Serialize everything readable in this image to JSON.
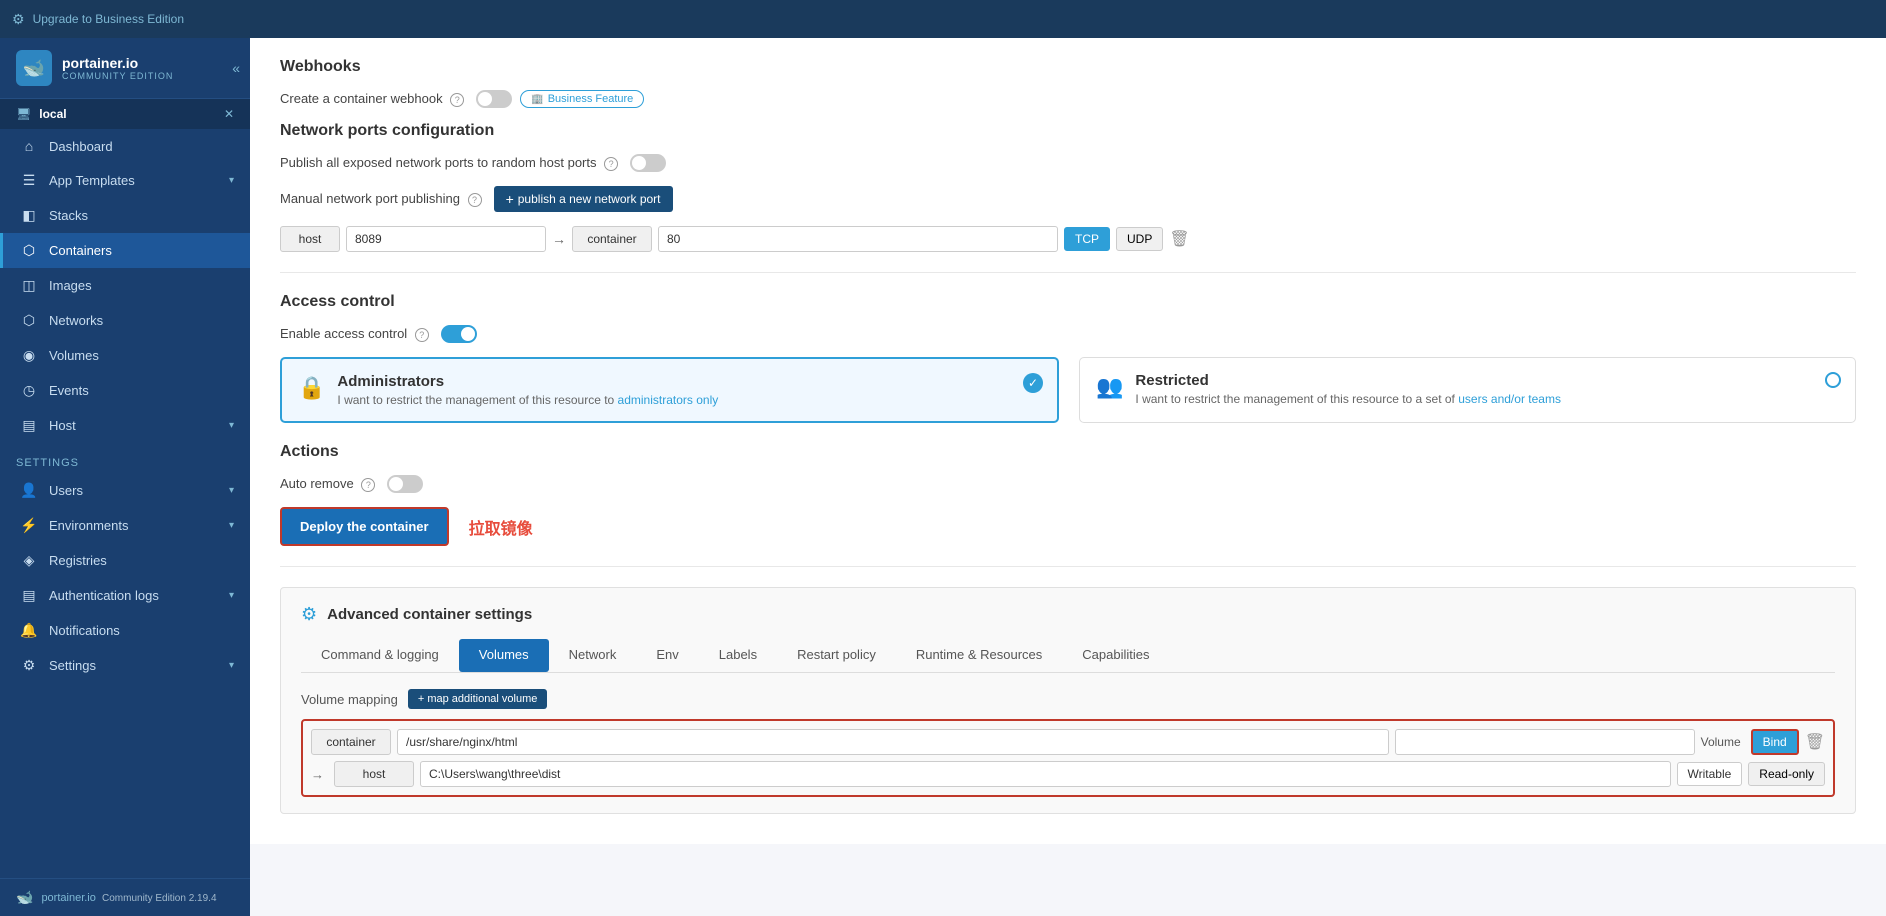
{
  "topBanner": {
    "icon": "⚙",
    "label": "Upgrade to Business Edition"
  },
  "sidebar": {
    "logo": {
      "name": "portainer.io",
      "edition": "COMMUNITY EDITION"
    },
    "envSection": {
      "name": "local",
      "closeIcon": "✕"
    },
    "navItems": [
      {
        "id": "dashboard",
        "icon": "⊞",
        "label": "Dashboard",
        "active": false
      },
      {
        "id": "app-templates",
        "icon": "☰",
        "label": "App Templates",
        "active": false,
        "hasChevron": true
      },
      {
        "id": "stacks",
        "icon": "◧",
        "label": "Stacks",
        "active": false
      },
      {
        "id": "containers",
        "icon": "⬡",
        "label": "Containers",
        "active": true
      },
      {
        "id": "images",
        "icon": "◫",
        "label": "Images",
        "active": false
      },
      {
        "id": "networks",
        "icon": "⬡",
        "label": "Networks",
        "active": false
      },
      {
        "id": "volumes",
        "icon": "◉",
        "label": "Volumes",
        "active": false
      },
      {
        "id": "events",
        "icon": "◷",
        "label": "Events",
        "active": false
      },
      {
        "id": "host",
        "icon": "▤",
        "label": "Host",
        "active": false,
        "hasChevron": true
      }
    ],
    "settingsSection": "Settings",
    "settingsItems": [
      {
        "id": "users",
        "icon": "👤",
        "label": "Users",
        "hasChevron": true
      },
      {
        "id": "environments",
        "icon": "⚡",
        "label": "Environments",
        "hasChevron": true
      },
      {
        "id": "registries",
        "icon": "◈",
        "label": "Registries"
      },
      {
        "id": "auth-logs",
        "icon": "▤",
        "label": "Authentication logs",
        "hasChevron": true
      },
      {
        "id": "notifications",
        "icon": "🔔",
        "label": "Notifications"
      },
      {
        "id": "settings",
        "icon": "⚙",
        "label": "Settings",
        "hasChevron": true
      }
    ],
    "footer": {
      "icon": "🐋",
      "text": "portainer.io",
      "version": "Community Edition 2.19.4"
    }
  },
  "main": {
    "webhooks": {
      "title": "Webhooks",
      "createLabel": "Create a container webhook",
      "toggleOn": false,
      "badgeLabel": "Business Feature"
    },
    "networkPorts": {
      "title": "Network ports configuration",
      "publishAllLabel": "Publish all exposed network ports to random host ports",
      "publishAllOn": false,
      "manualLabel": "Manual network port publishing",
      "publishBtnLabel": "+ publish a new network port",
      "portRow": {
        "hostLabel": "host",
        "hostVal": "8089",
        "containerLabel": "container",
        "containerVal": "80",
        "tcp": "TCP",
        "udp": "UDP"
      }
    },
    "accessControl": {
      "title": "Access control",
      "enableLabel": "Enable access control",
      "toggleOn": true,
      "cards": [
        {
          "id": "administrators",
          "icon": "🔒",
          "title": "Administrators",
          "desc": "I want to restrict the management of this resource to administrators only",
          "selected": true
        },
        {
          "id": "restricted",
          "icon": "👥",
          "title": "Restricted",
          "desc": "I want to restrict the management of this resource to a set of users and/or teams",
          "selected": false
        }
      ]
    },
    "actions": {
      "title": "Actions",
      "autoRemoveLabel": "Auto remove",
      "autoRemoveOn": false,
      "deployBtn": "Deploy the container",
      "deployHint": "拉取镜像"
    },
    "advanced": {
      "title": "Advanced container settings",
      "tabs": [
        {
          "id": "command",
          "label": "Command & logging",
          "active": false
        },
        {
          "id": "volumes",
          "label": "Volumes",
          "active": true
        },
        {
          "id": "network",
          "label": "Network",
          "active": false
        },
        {
          "id": "env",
          "label": "Env",
          "active": false
        },
        {
          "id": "labels",
          "label": "Labels",
          "active": false
        },
        {
          "id": "restart",
          "label": "Restart policy",
          "active": false
        },
        {
          "id": "runtime",
          "label": "Runtime & Resources",
          "active": false
        },
        {
          "id": "capabilities",
          "label": "Capabilities",
          "active": false
        }
      ],
      "volumeMapping": {
        "label": "Volume mapping",
        "mapBtnLabel": "+ map additional volume",
        "rows": [
          {
            "type": "container",
            "path": "/usr/share/nginx/html",
            "volumeType": "Bind",
            "isBind": true
          },
          {
            "type": "host",
            "path": "C:\\Users\\wang\\three\\dist",
            "writable": "Writable",
            "readonly": "Read-only"
          }
        ]
      }
    }
  }
}
